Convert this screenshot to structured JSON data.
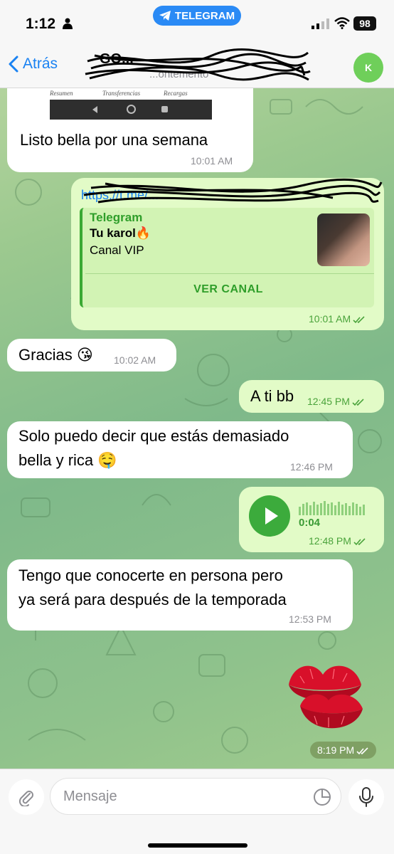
{
  "status_bar": {
    "time": "1:12",
    "app_pill": "TELEGRAM",
    "battery": "98"
  },
  "nav": {
    "back_label": "Atrás",
    "chat_title": "GO...",
    "chat_subtitle": "...ontemento",
    "avatar_initial": "K"
  },
  "screenshot_fragment": {
    "labels": [
      "Resumen",
      "Transferencias",
      "Recargas"
    ]
  },
  "messages": [
    {
      "id": "m1",
      "direction": "in",
      "text": "Listo bella por una semana",
      "time": "10:01 AM"
    },
    {
      "id": "m2",
      "direction": "out",
      "time": "10:01 AM",
      "read": true,
      "link": {
        "url": "https://t.me/...",
        "site": "Telegram",
        "title": "Tu karol🔥",
        "description": "Canal VIP",
        "button": "VER CANAL"
      }
    },
    {
      "id": "m3",
      "direction": "in",
      "text": "Gracias 😘",
      "time": "10:02 AM"
    },
    {
      "id": "m4",
      "direction": "out",
      "text": "A ti bb",
      "time": "12:45 PM",
      "read": true
    },
    {
      "id": "m5",
      "direction": "in",
      "text_lines": [
        "Solo puedo decir que estás demasiado",
        "bella y rica 🤤"
      ],
      "time": "12:46 PM"
    },
    {
      "id": "m6",
      "direction": "out",
      "voice": {
        "duration": "0:04"
      },
      "time": "12:48 PM",
      "read": true
    },
    {
      "id": "m7",
      "direction": "in",
      "text_lines": [
        "Tengo que conocerte en persona pero",
        "ya será para después de la temporada"
      ],
      "time": "12:53 PM"
    },
    {
      "id": "m8",
      "direction": "out",
      "sticker": "kiss-lips",
      "time": "8:19 PM",
      "read": true
    }
  ],
  "input": {
    "placeholder": "Mensaje"
  },
  "colors": {
    "accent": "#1a82f2",
    "out_bubble": "#e2fbc7",
    "in_bubble": "#ffffff",
    "telegram_green": "#3cab3c"
  }
}
